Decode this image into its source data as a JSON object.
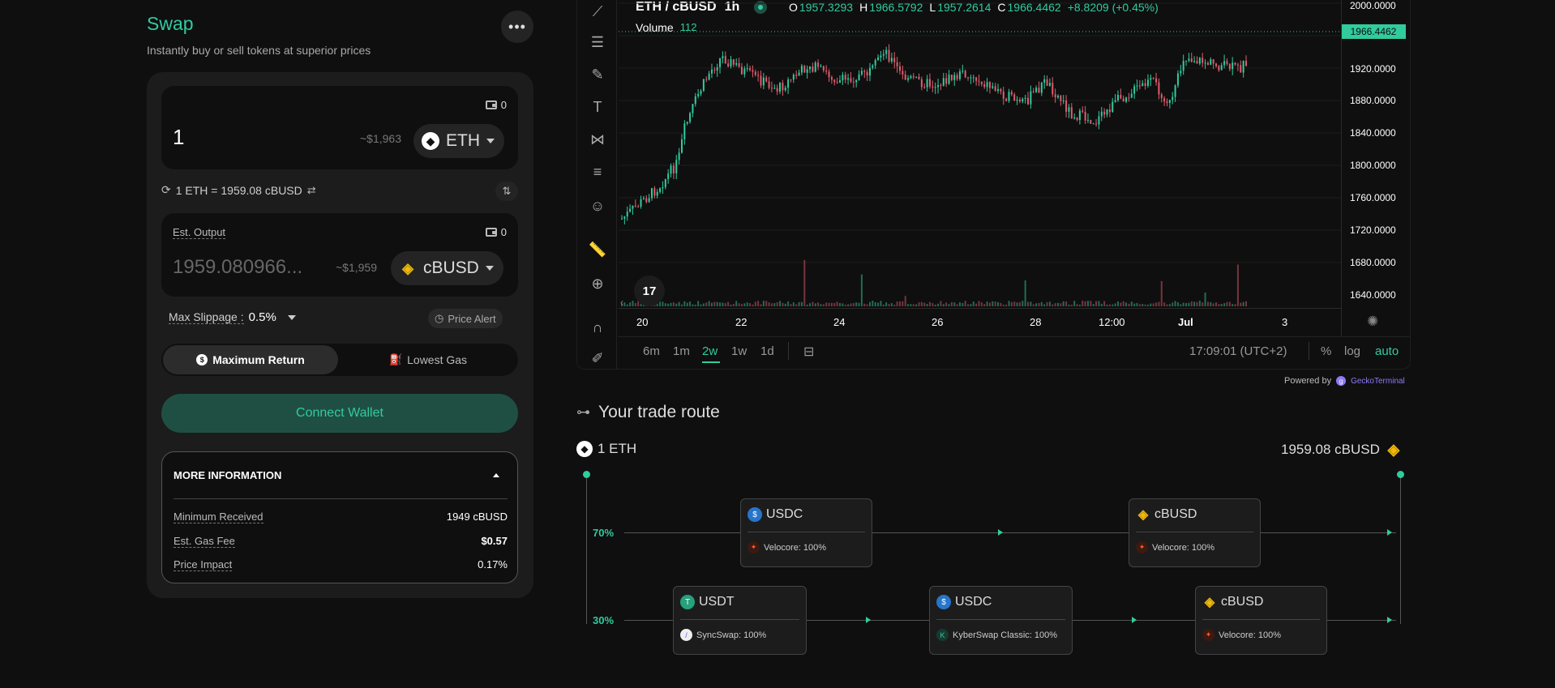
{
  "swap": {
    "title": "Swap",
    "subtitle": "Instantly buy or sell tokens at superior prices",
    "more_label": "•••",
    "input": {
      "amount": "1",
      "usd": "~$1,963",
      "token": "ETH",
      "balance": "0"
    },
    "rate": "1 ETH = 1959.08 cBUSD",
    "output": {
      "label": "Est. Output",
      "amount": "1959.080966...",
      "usd": "~$1,959",
      "token": "cBUSD",
      "balance": "0"
    },
    "slippage": {
      "label": "Max Slippage :",
      "value": "0.5%"
    },
    "price_alert": "Price Alert",
    "tabs": [
      {
        "label": "Maximum Return",
        "active": true
      },
      {
        "label": "Lowest Gas",
        "active": false
      }
    ],
    "connect_label": "Connect Wallet",
    "info": {
      "title": "MORE INFORMATION",
      "rows": [
        {
          "k": "Minimum Received",
          "v": "1949 cBUSD"
        },
        {
          "k": "Est. Gas Fee",
          "v": "$0.57"
        },
        {
          "k": "Price Impact",
          "v": "0.17%"
        }
      ]
    }
  },
  "chart": {
    "pair": "ETH / cBUSD",
    "interval": "1h",
    "ohlc": {
      "o_label": "O",
      "o": "1957.3293",
      "h_label": "H",
      "h": "1966.5792",
      "l_label": "L",
      "l": "1957.2614",
      "c_label": "C",
      "c": "1966.4462",
      "chg": "+8.8209 (+0.45%)"
    },
    "volume_label": "Volume",
    "volume_value": "112",
    "price_badge": "1966.4462",
    "price_ticks": [
      "2000.0000",
      "1920.0000",
      "1880.0000",
      "1840.0000",
      "1800.0000",
      "1760.0000",
      "1720.0000",
      "1680.0000",
      "1640.0000"
    ],
    "x_ticks": [
      "20",
      "22",
      "24",
      "26",
      "28",
      "12:00",
      "Jul",
      "3"
    ],
    "timeframes": [
      "6m",
      "1m",
      "2w",
      "1w",
      "1d"
    ],
    "active_timeframe": "2w",
    "clock": "17:09:01 (UTC+2)",
    "scale_opts": [
      "%",
      "log",
      "auto"
    ],
    "powered_by": "Powered by",
    "provider": "GeckoTerminal",
    "tv_logo": "17"
  },
  "route": {
    "title": "Your trade route",
    "from": "1 ETH",
    "to": "1959.08 cBUSD",
    "paths": [
      {
        "pct": "70%",
        "hops": [
          {
            "token": "USDC",
            "pool": "Velocore: 100%"
          },
          {
            "token": "cBUSD",
            "pool": "Velocore: 100%"
          }
        ]
      },
      {
        "pct": "30%",
        "hops": [
          {
            "token": "USDT",
            "pool": "SyncSwap: 100%"
          },
          {
            "token": "USDC",
            "pool": "KyberSwap Classic: 100%"
          },
          {
            "token": "cBUSD",
            "pool": "Velocore: 100%"
          }
        ]
      }
    ]
  },
  "colors": {
    "accent": "#31cb9e",
    "up": "#31cb9e",
    "down": "#e05c6e",
    "busd": "#f0b90b"
  }
}
